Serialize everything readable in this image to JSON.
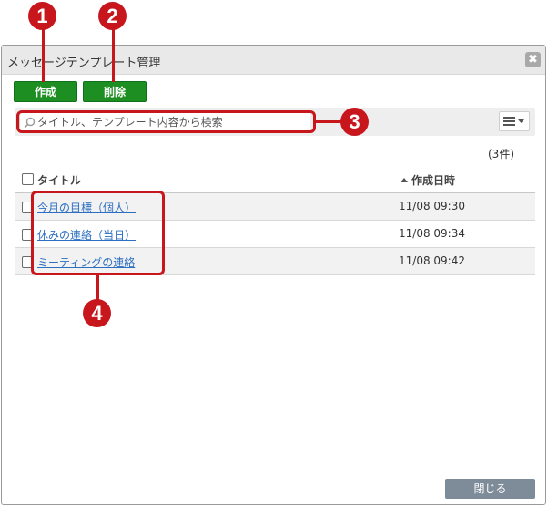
{
  "dialog": {
    "title": "メッセージテンプレート管理",
    "close_symbol": "✖"
  },
  "toolbar": {
    "create_label": "作成",
    "delete_label": "削除"
  },
  "search": {
    "placeholder": "タイトル、テンプレート内容から検索"
  },
  "list": {
    "count_text": "(3件)",
    "headers": {
      "title": "タイトル",
      "created": "作成日時"
    },
    "sort": "created-ascending",
    "rows": [
      {
        "title": "今月の目標（個人）",
        "created": "11/08 09:30"
      },
      {
        "title": "休みの連絡（当日）",
        "created": "11/08 09:34"
      },
      {
        "title": "ミーティングの連絡",
        "created": "11/08 09:42"
      }
    ]
  },
  "footer": {
    "close_label": "閉じる"
  },
  "callouts": [
    "1",
    "2",
    "3",
    "4"
  ],
  "colors": {
    "accent_green": "#1d8e21",
    "callout_red": "#c8161d",
    "link_blue": "#2c6fc1",
    "close_button": "#7e8b99"
  }
}
